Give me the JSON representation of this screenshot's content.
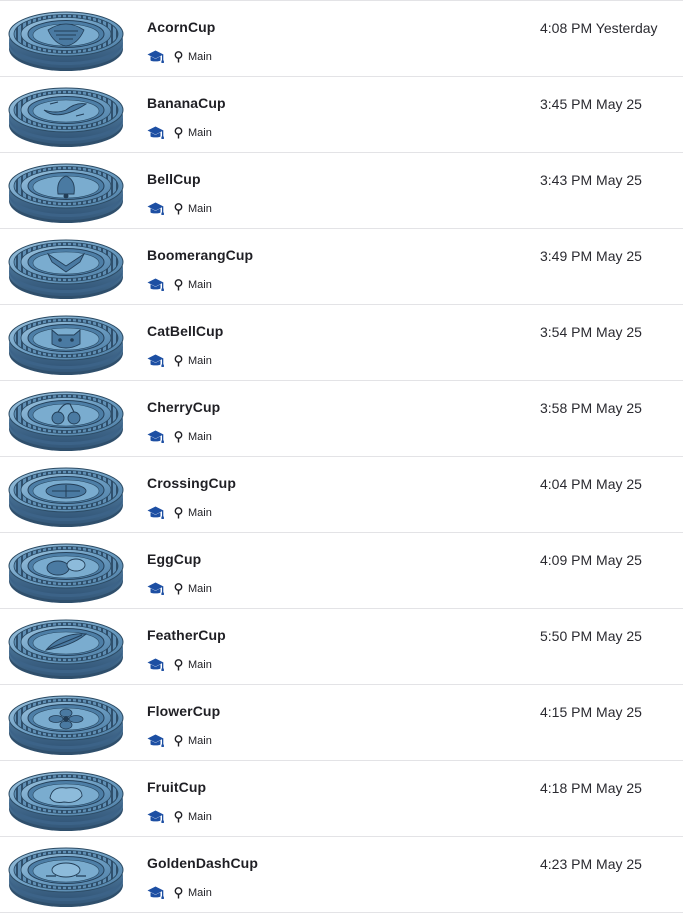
{
  "documents": [
    {
      "name": "AcornCup",
      "modified": "4:08 PM Yesterday",
      "branch": "Main",
      "thumbnail_icon": "acorn-cup-3d-model",
      "badge_icon": "graduation-cap-icon"
    },
    {
      "name": "BananaCup",
      "modified": "3:45 PM May 25",
      "branch": "Main",
      "thumbnail_icon": "banana-cup-3d-model",
      "badge_icon": "graduation-cap-icon"
    },
    {
      "name": "BellCup",
      "modified": "3:43 PM May 25",
      "branch": "Main",
      "thumbnail_icon": "bell-cup-3d-model",
      "badge_icon": "graduation-cap-icon"
    },
    {
      "name": "BoomerangCup",
      "modified": "3:49 PM May 25",
      "branch": "Main",
      "thumbnail_icon": "boomerang-cup-3d-model",
      "badge_icon": "graduation-cap-icon"
    },
    {
      "name": "CatBellCup",
      "modified": "3:54 PM May 25",
      "branch": "Main",
      "thumbnail_icon": "catbell-cup-3d-model",
      "badge_icon": "graduation-cap-icon"
    },
    {
      "name": "CherryCup",
      "modified": "3:58 PM May 25",
      "branch": "Main",
      "thumbnail_icon": "cherry-cup-3d-model",
      "badge_icon": "graduation-cap-icon"
    },
    {
      "name": "CrossingCup",
      "modified": "4:04 PM May 25",
      "branch": "Main",
      "thumbnail_icon": "crossing-cup-3d-model",
      "badge_icon": "graduation-cap-icon"
    },
    {
      "name": "EggCup",
      "modified": "4:09 PM May 25",
      "branch": "Main",
      "thumbnail_icon": "egg-cup-3d-model",
      "badge_icon": "graduation-cap-icon"
    },
    {
      "name": "FeatherCup",
      "modified": "5:50 PM May 25",
      "branch": "Main",
      "thumbnail_icon": "feather-cup-3d-model",
      "badge_icon": "graduation-cap-icon"
    },
    {
      "name": "FlowerCup",
      "modified": "4:15 PM May 25",
      "branch": "Main",
      "thumbnail_icon": "flower-cup-3d-model",
      "badge_icon": "graduation-cap-icon"
    },
    {
      "name": "FruitCup",
      "modified": "4:18 PM May 25",
      "branch": "Main",
      "thumbnail_icon": "fruit-cup-3d-model",
      "badge_icon": "graduation-cap-icon"
    },
    {
      "name": "GoldenDashCup",
      "modified": "4:23 PM May 25",
      "branch": "Main",
      "thumbnail_icon": "goldendash-cup-3d-model",
      "badge_icon": "graduation-cap-icon"
    }
  ],
  "colors": {
    "accent": "#1d4fa3",
    "model_fill": "#6b9dc2",
    "model_dark": "#2b4a63",
    "divider": "#e3e3e6",
    "text": "#1f1f24"
  }
}
